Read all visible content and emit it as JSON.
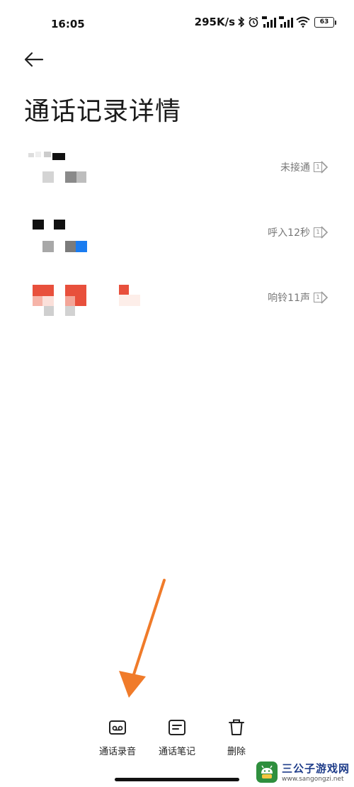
{
  "status_bar": {
    "time": "16:05",
    "net_speed": "295K/s",
    "battery": "63"
  },
  "header": {
    "title": "通话记录详情"
  },
  "call_records": [
    {
      "status": "未接通",
      "sim": "1"
    },
    {
      "status": "呼入12秒",
      "sim": "1"
    },
    {
      "status": "响铃11声",
      "sim": "1"
    }
  ],
  "toolbar": {
    "record_label": "通话录音",
    "notes_label": "通话笔记",
    "delete_label": "删除"
  },
  "watermark": {
    "title": "三公子游戏网",
    "url": "www.sangongzi.net"
  },
  "colors": {
    "accent_arrow": "#f07b2a",
    "pixel_blue": "#1a7cf0",
    "pixel_red": "#e8503c"
  }
}
